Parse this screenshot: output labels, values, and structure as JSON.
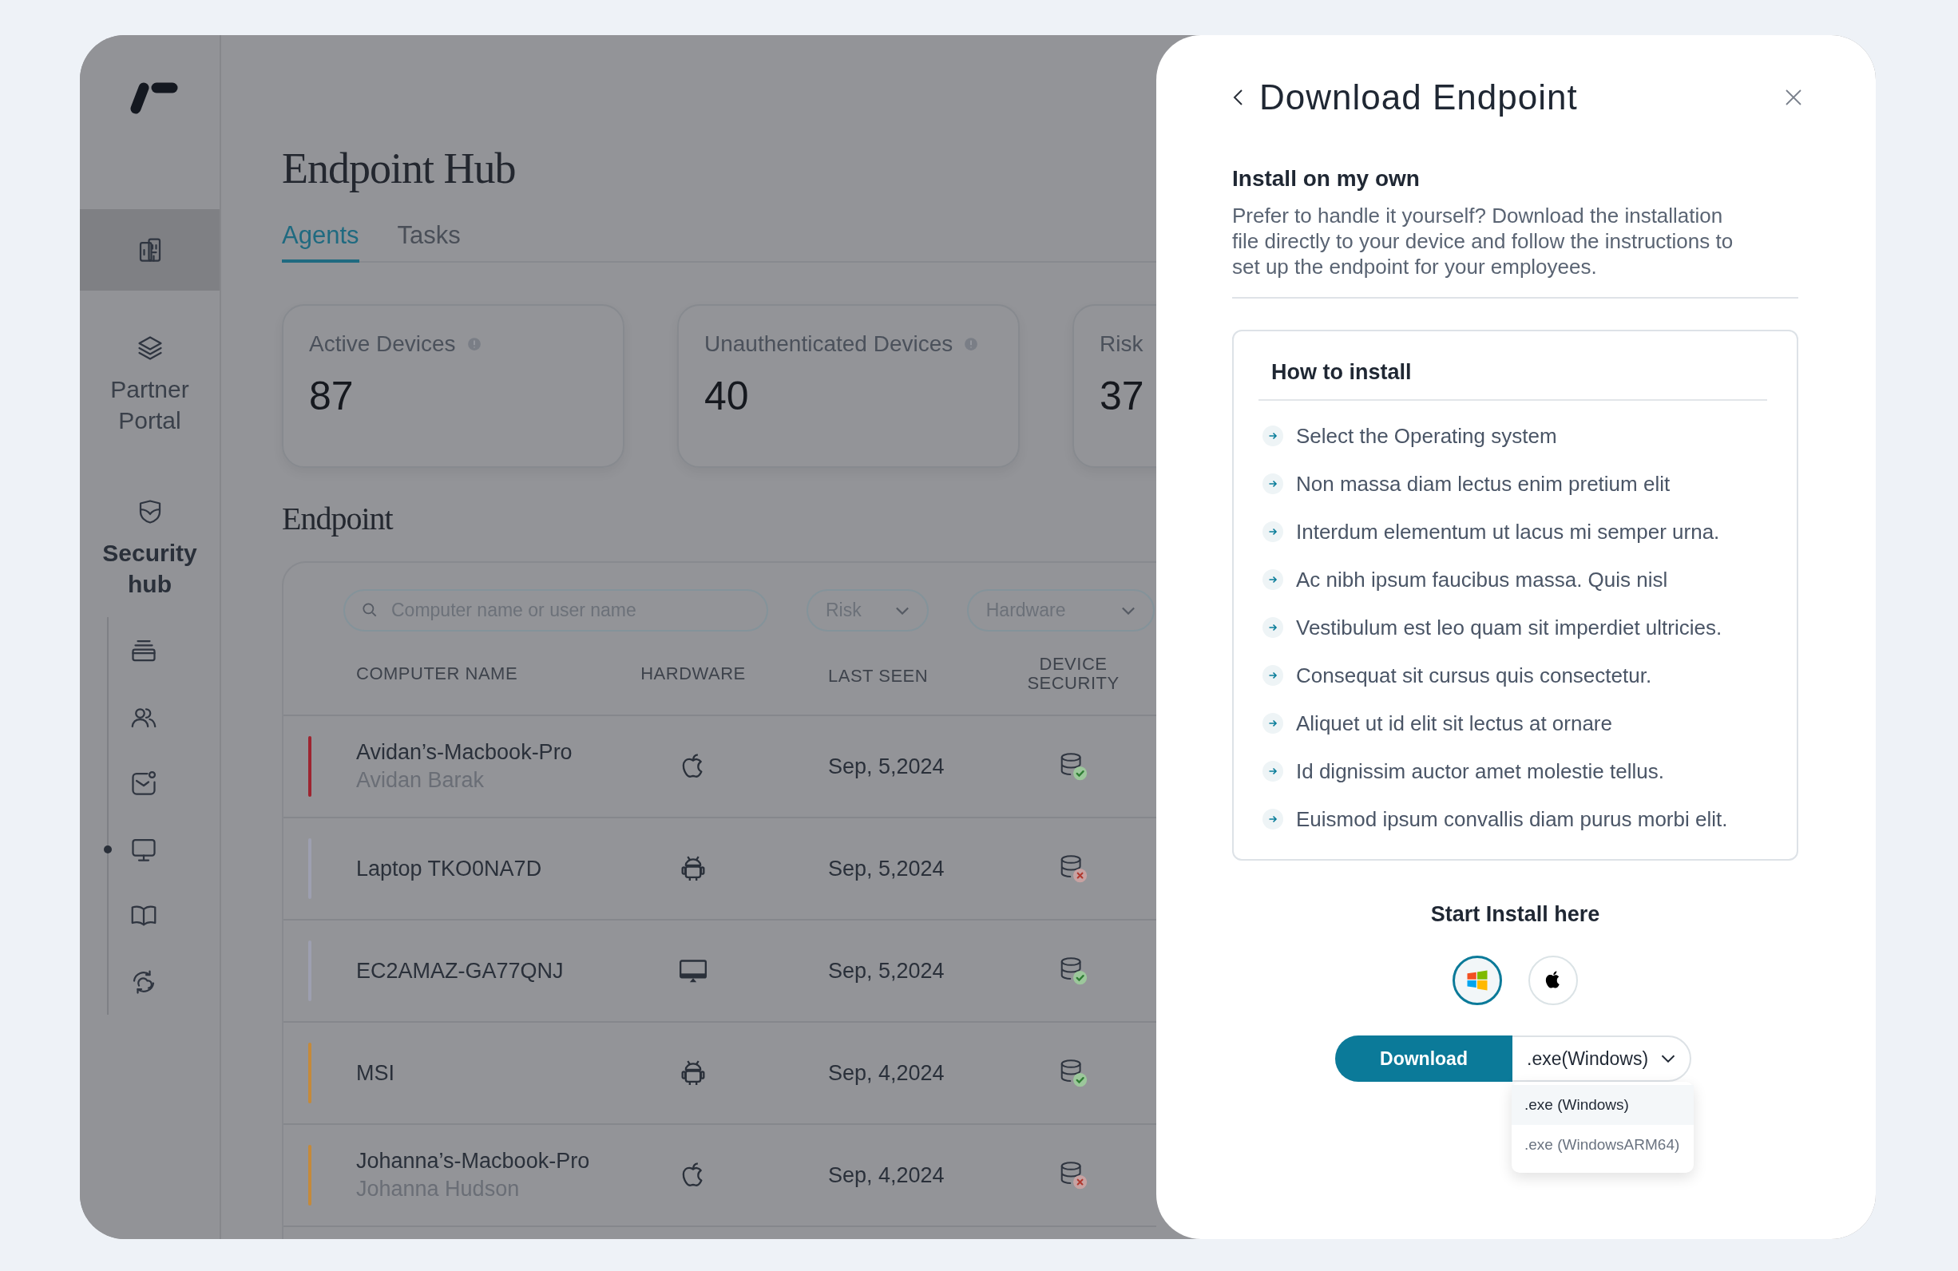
{
  "sidebar": {
    "items": [
      {
        "kind": "building",
        "selected": true
      },
      {
        "kind": "layers",
        "label": "Partner Portal",
        "selected": false
      },
      {
        "kind": "shield",
        "label": "Security hub",
        "selected": true,
        "children": [
          {
            "kind": "stack",
            "selected": false
          },
          {
            "kind": "users",
            "selected": false
          },
          {
            "kind": "mail",
            "selected": false
          },
          {
            "kind": "monitor",
            "selected": true
          },
          {
            "kind": "book",
            "selected": false
          },
          {
            "kind": "sync",
            "selected": false
          }
        ]
      }
    ]
  },
  "page": {
    "title": "Endpoint Hub",
    "tabs": [
      {
        "label": "Agents",
        "selected": true
      },
      {
        "label": "Tasks",
        "selected": false
      }
    ],
    "stats": [
      {
        "label": "Active Devices",
        "value": "87",
        "info": true
      },
      {
        "label": "Unauthenticated Devices",
        "value": "40",
        "info": true
      },
      {
        "label": "Risk",
        "value": "37",
        "info": false
      }
    ],
    "section_title": "Endpoint",
    "search": {
      "placeholder": "Computer name or user name"
    },
    "filters": [
      {
        "label": "Risk"
      },
      {
        "label": "Hardware"
      }
    ],
    "table": {
      "columns": [
        "COMPUTER NAME",
        "HARDWARE",
        "LAST SEEN",
        "DEVICE SECURITY"
      ],
      "rows": [
        {
          "name": "Avidan’s-Macbook-Pro",
          "user": "Avidan Barak",
          "hardware": {
            "kind": "apple"
          },
          "last_seen": "Sep, 5,2024",
          "secure": true,
          "color": "#9e2430"
        },
        {
          "name": "Laptop TKO0NA7D",
          "hardware": {
            "kind": "android"
          },
          "last_seen": "Sep, 5,2024",
          "secure": false,
          "color": "#9d9fb0"
        },
        {
          "name": "EC2AMAZ-GA77QNJ",
          "hardware": {
            "kind": "desktop"
          },
          "last_seen": "Sep, 5,2024",
          "secure": true,
          "color": "#9d9fb0"
        },
        {
          "name": "MSI",
          "hardware": {
            "kind": "android"
          },
          "last_seen": "Sep, 4,2024",
          "secure": true,
          "color": "#c58a3a"
        },
        {
          "name": "Johanna’s-Macbook-Pro",
          "user": "Johanna Hudson",
          "hardware": {
            "kind": "apple"
          },
          "last_seen": "Sep, 4,2024",
          "secure": false,
          "color": "#c58a3a"
        }
      ]
    }
  },
  "drawer": {
    "title": "Download Endpoint",
    "section_title": "Install on my own",
    "description": "Prefer to handle it yourself? Download the installation file directly to your device and follow the instructions to set up the endpoint for your employees.",
    "howto": {
      "title": "How to install",
      "steps": [
        "Select the Operating system",
        "Non massa diam lectus enim pretium elit",
        "Interdum elementum ut lacus mi semper urna.",
        "Ac nibh ipsum faucibus massa. Quis nisl",
        "Vestibulum est leo quam sit imperdiet ultricies.",
        "Consequat sit cursus quis consectetur.",
        "Aliquet ut id elit sit lectus at ornare",
        "Id dignissim auctor amet molestie tellus.",
        "Euismod ipsum convallis diam purus morbi elit."
      ]
    },
    "start_title": "Start Install here",
    "os_options": [
      {
        "kind": "windows",
        "selected": true
      },
      {
        "kind": "apple",
        "selected": false
      }
    ],
    "download": {
      "label": "Download",
      "format": ".exe(Windows)",
      "menu": [
        {
          "label": ".exe (Windows)",
          "selected": true
        },
        {
          "label": ".exe (WindowsARM64)",
          "selected": false
        }
      ]
    }
  }
}
